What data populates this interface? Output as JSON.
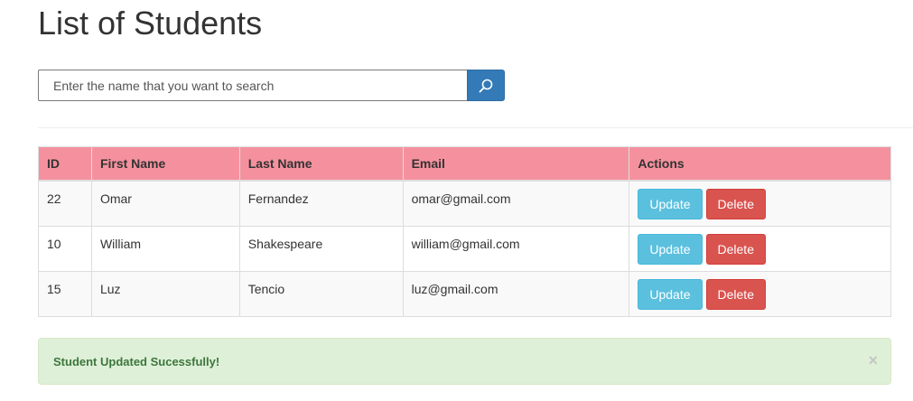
{
  "page": {
    "title": "List of Students"
  },
  "search": {
    "placeholder": "Enter the name that you want to search",
    "button_icon": "search-icon"
  },
  "table": {
    "columns": [
      "ID",
      "First Name",
      "Last Name",
      "Email",
      "Actions"
    ],
    "rows": [
      {
        "id": "22",
        "first_name": "Omar",
        "last_name": "Fernandez",
        "email": "omar@gmail.com"
      },
      {
        "id": "10",
        "first_name": "William",
        "last_name": "Shakespeare",
        "email": "william@gmail.com"
      },
      {
        "id": "15",
        "first_name": "Luz",
        "last_name": "Tencio",
        "email": "luz@gmail.com"
      }
    ],
    "update_label": "Update",
    "delete_label": "Delete"
  },
  "alert": {
    "message": "Student Updated Sucessfully!",
    "close_label": "×"
  },
  "colors": {
    "header_bg": "#f5919e",
    "primary": "#337ab7",
    "info": "#5bc0de",
    "danger": "#d9534f",
    "success_bg": "#dff0d8",
    "success_text": "#3c763d"
  }
}
